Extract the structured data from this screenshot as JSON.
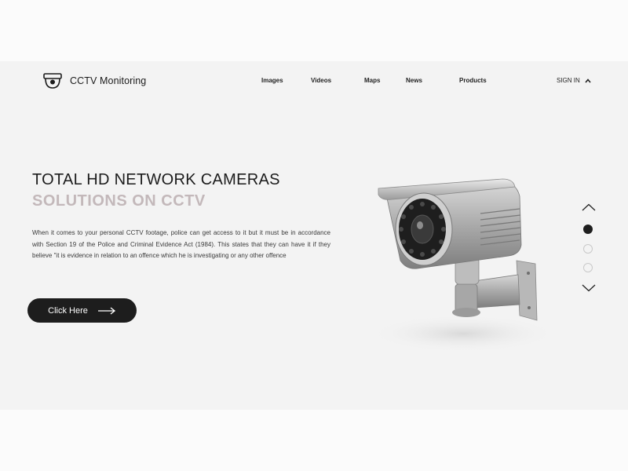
{
  "header": {
    "brand": "CCTV Monitoring",
    "logo_icon": "cctv-dome-icon",
    "nav": [
      "Images",
      "Videos",
      "Maps",
      "News",
      "Products"
    ],
    "signin_label": "SIGN IN",
    "signin_icon": "chevron-up-icon"
  },
  "hero": {
    "title_line1": "TOTAL HD NETWORK CAMERAS",
    "title_line2": "SOLUTIONS ON CCTV",
    "description": "When it comes to your personal CCTV footage, police can get access to it but it must be in accordance with Section 19 of the Police and Criminal Evidence Act (1984). This states that they can have it if they believe \"it is evidence in relation to an offence which he is investigating or any other offence",
    "cta_label": "Click Here",
    "cta_icon": "arrow-right-icon",
    "image": "cctv-camera-image"
  },
  "slider": {
    "up_icon": "chevron-up-icon",
    "down_icon": "chevron-down-icon",
    "active_index": 0,
    "total": 3
  },
  "colors": {
    "background": "#f3f3f3",
    "title_dark": "#1c1c1c",
    "title_accent": "#c3b8ba",
    "button_bg": "#1d1d1d"
  }
}
